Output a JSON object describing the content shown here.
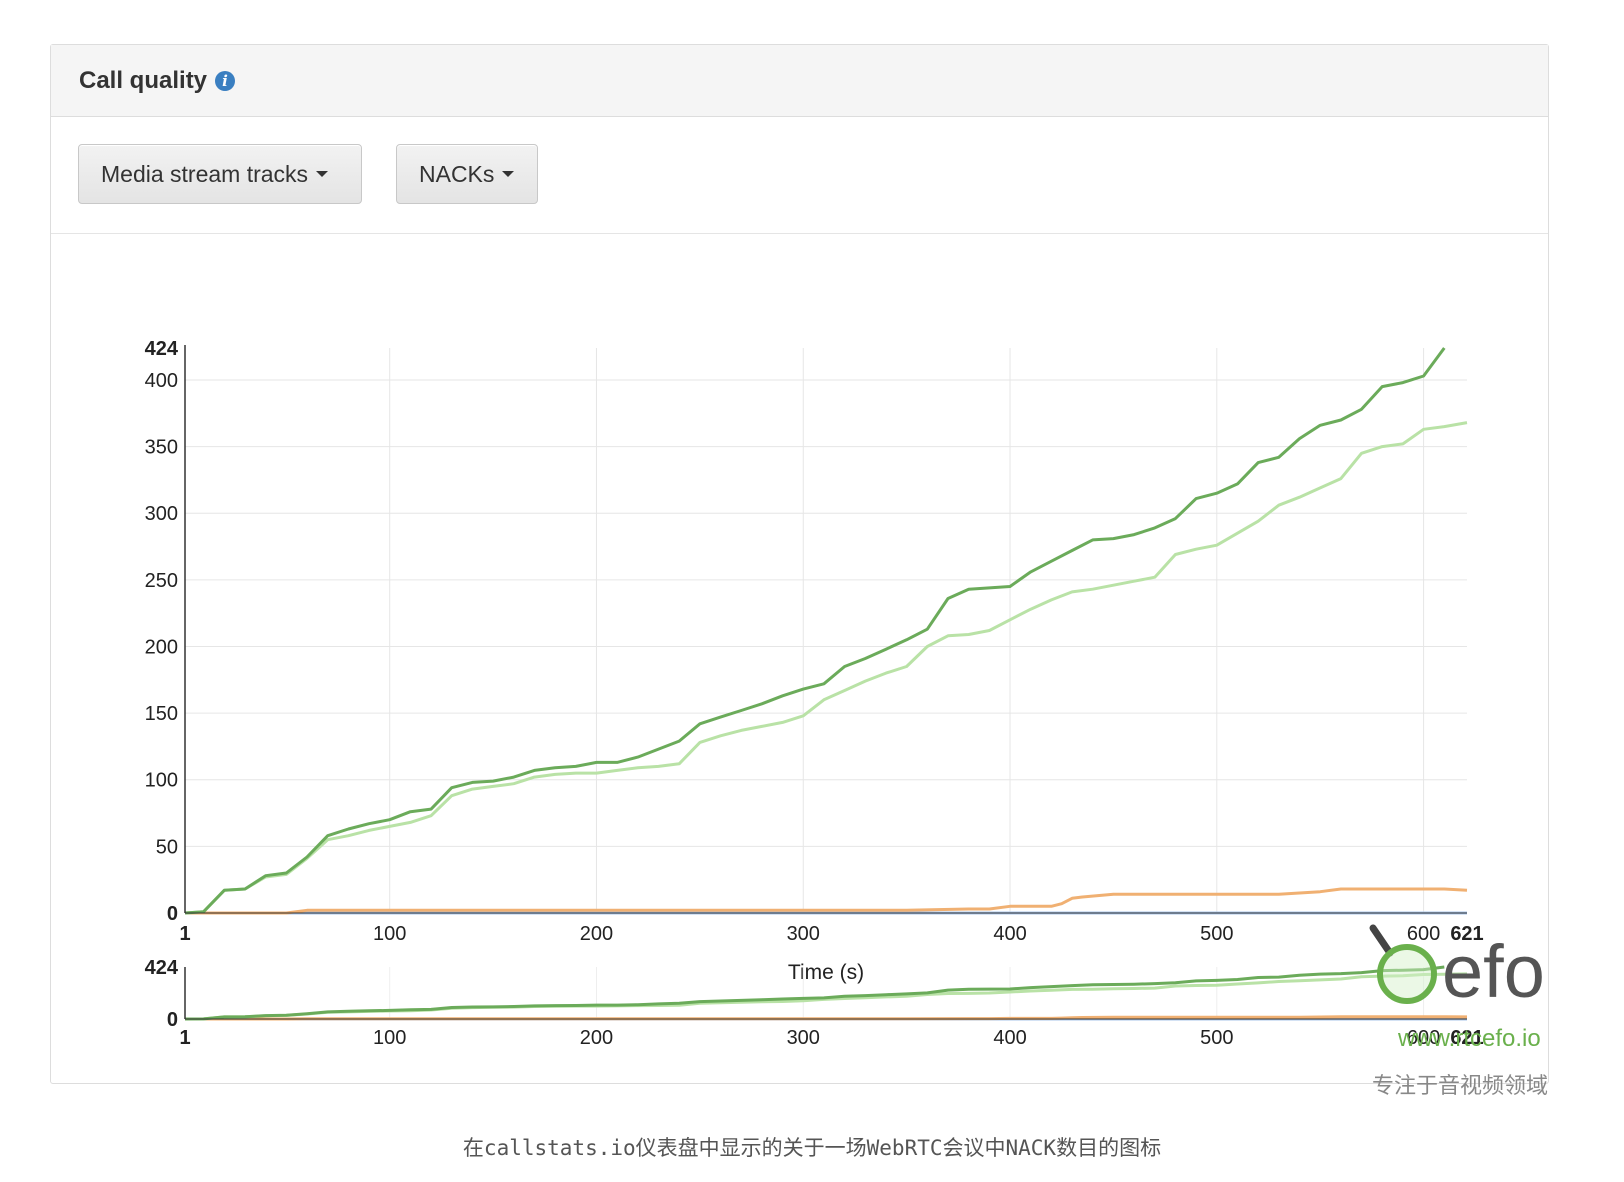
{
  "panel": {
    "title": "Call quality",
    "info_icon": "info-icon",
    "buttons": [
      {
        "label": "Media stream tracks",
        "icon": "caret-down-icon"
      },
      {
        "label": "NACKs",
        "icon": "caret-down-icon"
      }
    ]
  },
  "chart_data": {
    "type": "line",
    "title": "",
    "xlabel": "Time (s)",
    "ylabel": "",
    "xlim": [
      1,
      621
    ],
    "ylim": [
      0,
      424
    ],
    "x_ticks": [
      100,
      200,
      300,
      400,
      500,
      600
    ],
    "x_tick_labels": [
      "100",
      "200",
      "300",
      "400",
      "500",
      "600"
    ],
    "x_range_labels": [
      "1",
      "621"
    ],
    "y_ticks": [
      0,
      50,
      100,
      150,
      200,
      250,
      300,
      350,
      400
    ],
    "y_tick_labels": [
      "0",
      "50",
      "100",
      "150",
      "200",
      "250",
      "300",
      "350",
      "400"
    ],
    "y_max_label": "424",
    "grid": true,
    "navigator": {
      "y_labels": [
        "424",
        "0"
      ],
      "x_tick_labels": [
        "100",
        "200",
        "300",
        "400",
        "500",
        "600"
      ],
      "x_range_labels": [
        "1",
        "621"
      ]
    },
    "series": [
      {
        "color": "#6bab5a",
        "x": [
          1,
          10,
          20,
          30,
          40,
          50,
          60,
          70,
          80,
          90,
          100,
          110,
          120,
          130,
          140,
          150,
          160,
          170,
          180,
          190,
          200,
          210,
          220,
          230,
          240,
          250,
          260,
          270,
          280,
          290,
          300,
          310,
          320,
          330,
          340,
          350,
          360,
          370,
          380,
          390,
          400,
          410,
          420,
          430,
          440,
          450,
          460,
          470,
          480,
          490,
          500,
          510,
          520,
          530,
          540,
          550,
          560,
          570,
          580,
          590,
          600,
          610
        ],
        "values": [
          0,
          1,
          17,
          18,
          28,
          30,
          42,
          58,
          63,
          67,
          70,
          76,
          78,
          94,
          98,
          99,
          102,
          107,
          109,
          110,
          113,
          113,
          117,
          123,
          129,
          142,
          147,
          152,
          157,
          163,
          168,
          172,
          185,
          191,
          198,
          205,
          213,
          236,
          243,
          244,
          245,
          256,
          264,
          272,
          280,
          281,
          284,
          289,
          296,
          311,
          315,
          322,
          338,
          342,
          356,
          366,
          370,
          378,
          395,
          398,
          403,
          424
        ]
      },
      {
        "color": "#b9e2a6",
        "x": [
          1,
          10,
          20,
          30,
          40,
          50,
          60,
          70,
          80,
          90,
          100,
          110,
          120,
          130,
          140,
          150,
          160,
          170,
          180,
          190,
          200,
          210,
          220,
          230,
          240,
          250,
          260,
          270,
          280,
          290,
          300,
          310,
          320,
          330,
          340,
          350,
          360,
          370,
          380,
          390,
          400,
          410,
          420,
          430,
          440,
          450,
          460,
          470,
          480,
          490,
          500,
          510,
          520,
          530,
          540,
          550,
          560,
          570,
          580,
          590,
          600,
          610,
          621
        ],
        "values": [
          0,
          1,
          17,
          18,
          27,
          29,
          41,
          55,
          58,
          62,
          65,
          68,
          73,
          88,
          93,
          95,
          97,
          102,
          104,
          105,
          105,
          107,
          109,
          110,
          112,
          128,
          133,
          137,
          140,
          143,
          148,
          160,
          167,
          174,
          180,
          185,
          200,
          208,
          209,
          212,
          220,
          228,
          235,
          241,
          243,
          246,
          249,
          252,
          269,
          273,
          276,
          285,
          294,
          306,
          312,
          319,
          326,
          345,
          350,
          352,
          363,
          365,
          368
        ]
      },
      {
        "color": "#f0b072",
        "x": [
          1,
          30,
          50,
          60,
          100,
          200,
          300,
          350,
          380,
          390,
          400,
          420,
          425,
          430,
          435,
          450,
          460,
          480,
          500,
          520,
          530,
          540,
          550,
          560,
          580,
          600,
          610,
          621
        ],
        "values": [
          0,
          0,
          0,
          2,
          2,
          2,
          2,
          2,
          3,
          3,
          5,
          5,
          7,
          11,
          12,
          14,
          14,
          14,
          14,
          14,
          14,
          15,
          16,
          18,
          18,
          18,
          18,
          17
        ]
      },
      {
        "color": "#a9c4e8",
        "x": [
          1,
          621
        ],
        "values": [
          0,
          0
        ]
      }
    ]
  },
  "watermark": {
    "brand": "efo",
    "url": "www.rtcefo.io",
    "slogan": "专注于音视频领域"
  },
  "caption": "在callstats.io仪表盘中显示的关于一场WebRTC会议中NACK数目的图标"
}
